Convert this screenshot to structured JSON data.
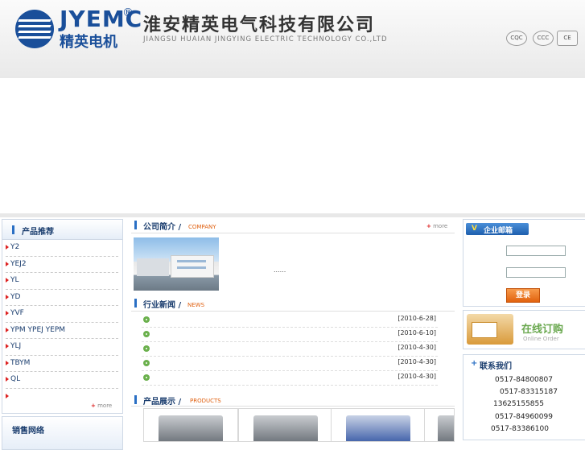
{
  "header": {
    "logo_en": "JYEMC",
    "logo_reg": "®",
    "logo_cn": "精英电机",
    "company_cn": "淮安精英电气科技有限公司",
    "company_en": "JIANGSU HUAIAN JINGYING ELECTRIC TECHNOLOGY CO.,LTD",
    "certs": [
      "CQC",
      "CCC",
      "CE"
    ]
  },
  "products_box": {
    "title": "产品推荐",
    "items": [
      "Y2",
      "YEJ2",
      "YL",
      "YD",
      "YVF",
      "YPM YPEJ YEPM",
      "YLJ",
      "TBYM",
      "QL",
      ""
    ],
    "more": "more"
  },
  "sales_box": {
    "title": "销售网络"
  },
  "company_intro": {
    "title": "公司简介",
    "title_en": "COMPANY",
    "more": "more",
    "summary": "......"
  },
  "news": {
    "title": "行业新闻",
    "title_en": "NEWS",
    "items": [
      {
        "date": "[2010-6-28]"
      },
      {
        "date": "[2010-6-10]"
      },
      {
        "date": "[2010-4-30]"
      },
      {
        "date": "[2010-4-30]"
      },
      {
        "date": "[2010-4-30]"
      }
    ]
  },
  "products_show": {
    "title": "产品展示",
    "title_en": "PRODUCTS"
  },
  "email_box": {
    "title": "企业邮箱",
    "v_mark": "V",
    "login_label": "登录"
  },
  "order": {
    "title_cn": "在线订购",
    "title_en": "Online Order"
  },
  "contact": {
    "title": "联系我们",
    "plus": "+",
    "phones": [
      "0517-84800807",
      "0517-83315187",
      "13625155855",
      "0517-84960099",
      "0517-83386100"
    ]
  },
  "colors": {
    "brand": "#1a4f9a",
    "accent": "#e06010",
    "heading": "#1a3d6e"
  }
}
